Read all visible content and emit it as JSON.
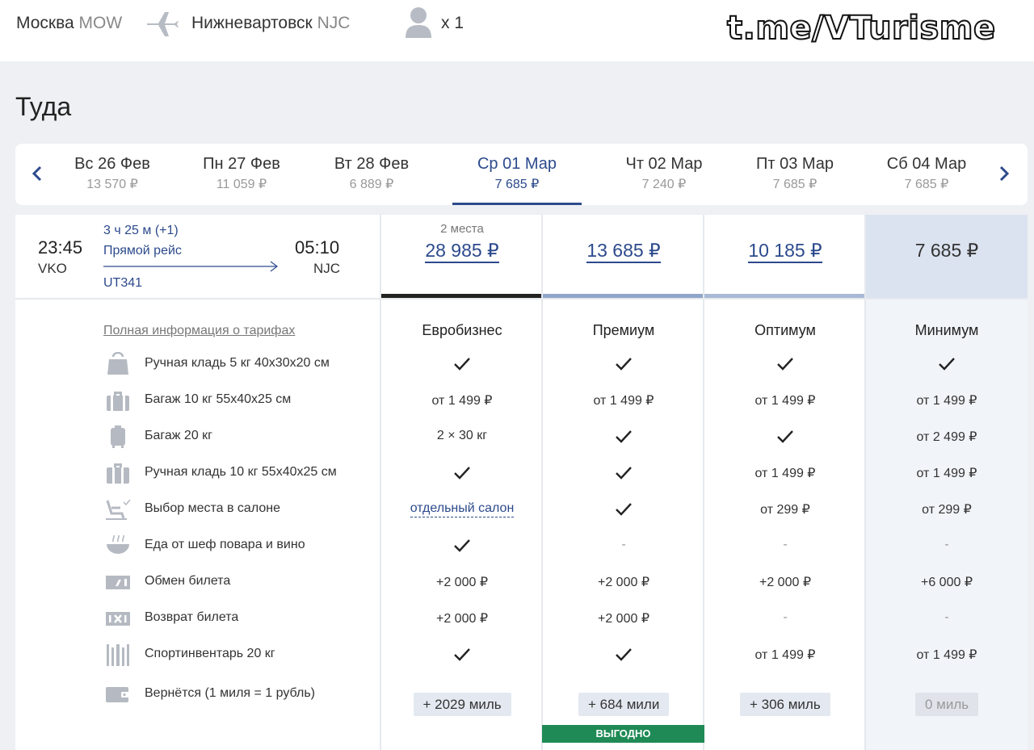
{
  "header": {
    "from_city": "Москва",
    "from_code": "MOW",
    "to_city": "Нижневартовск",
    "to_code": "NJC",
    "passengers": "x 1",
    "watermark": "t.me/VTurisme"
  },
  "section_title": "Туда",
  "dates": [
    {
      "day": "Вс 26 Фев",
      "price": "13 570 ₽"
    },
    {
      "day": "Пн 27 Фев",
      "price": "11 059 ₽"
    },
    {
      "day": "Вт 28 Фев",
      "price": "6 889 ₽"
    },
    {
      "day": "Ср 01 Мар",
      "price": "7 685 ₽",
      "active": true
    },
    {
      "day": "Чт 02 Мар",
      "price": "7 240 ₽"
    },
    {
      "day": "Пт 03 Мар",
      "price": "7 685 ₽"
    },
    {
      "day": "Сб 04 Мар",
      "price": "7 685 ₽"
    }
  ],
  "flight": {
    "dep_time": "23:45",
    "dep_code": "VKO",
    "duration": "3 ч 25 м  (+1)",
    "type": "Прямой рейс",
    "number": "UT341",
    "arr_time": "05:10",
    "arr_code": "NJC"
  },
  "fares": [
    {
      "name": "Евробизнес",
      "price": "28 985 ₽",
      "seats": "2 места",
      "bar_color": "#222222",
      "miles": "+ 2029 миль"
    },
    {
      "name": "Премиум",
      "price": "13 685 ₽",
      "seats": "",
      "bar_color": "#8fa6c9",
      "miles": "+ 684 мили",
      "badge": "ВЫГОДНО"
    },
    {
      "name": "Оптимум",
      "price": "10 185 ₽",
      "seats": "",
      "bar_color": "#a9bad6",
      "miles": "+ 306 миль"
    },
    {
      "name": "Минимум",
      "price": "7 685 ₽",
      "seats": "",
      "bar_color": "#dbe3f0",
      "miles": "0 миль"
    }
  ],
  "full_info_link": "Полная информация о тарифах",
  "features": [
    {
      "label": "Ручная кладь 5 кг 40х30х20 см",
      "icon": "handbag-icon",
      "values": [
        "✓",
        "✓",
        "✓",
        "✓"
      ]
    },
    {
      "label": "Багаж 10 кг 55х40х25 см",
      "icon": "suitcase-icon",
      "values": [
        "от 1 499 ₽",
        "от 1 499 ₽",
        "от 1 499 ₽",
        "от 1 499 ₽"
      ]
    },
    {
      "label": "Багаж 20 кг",
      "icon": "luggage-icon",
      "values": [
        "2 × 30 кг",
        "✓",
        "✓",
        "от 2 499 ₽"
      ]
    },
    {
      "label": "Ручная кладь 10 кг 55х40х25 см",
      "icon": "carryon-icon",
      "values": [
        "✓",
        "✓",
        "от 1 499 ₽",
        "от 1 499 ₽"
      ]
    },
    {
      "label": "Выбор места в салоне",
      "icon": "seat-icon",
      "values": [
        "отдельный салон",
        "✓",
        "от 299 ₽",
        "от 299 ₽"
      ]
    },
    {
      "label": "Еда от шеф повара и вино",
      "icon": "meal-icon",
      "values": [
        "✓",
        "-",
        "-",
        "-"
      ]
    },
    {
      "label": "Обмен билета",
      "icon": "ticket-exchange-icon",
      "values": [
        "+2 000 ₽",
        "+2 000 ₽",
        "+2 000 ₽",
        "+6 000 ₽"
      ]
    },
    {
      "label": "Возврат билета",
      "icon": "ticket-refund-icon",
      "values": [
        "+2 000 ₽",
        "+2 000 ₽",
        "-",
        "-"
      ]
    },
    {
      "label": "Спортинвентарь 20 кг",
      "icon": "sport-equipment-icon",
      "values": [
        "✓",
        "✓",
        "от 1 499 ₽",
        "от 1 499 ₽"
      ]
    },
    {
      "label": "Вернётся (1 миля = 1 рубль)",
      "icon": "wallet-icon",
      "values": []
    }
  ],
  "colors": {
    "accent": "#2c4a8c",
    "badge": "#1f8a55",
    "min_column": "#f1f4f9"
  }
}
